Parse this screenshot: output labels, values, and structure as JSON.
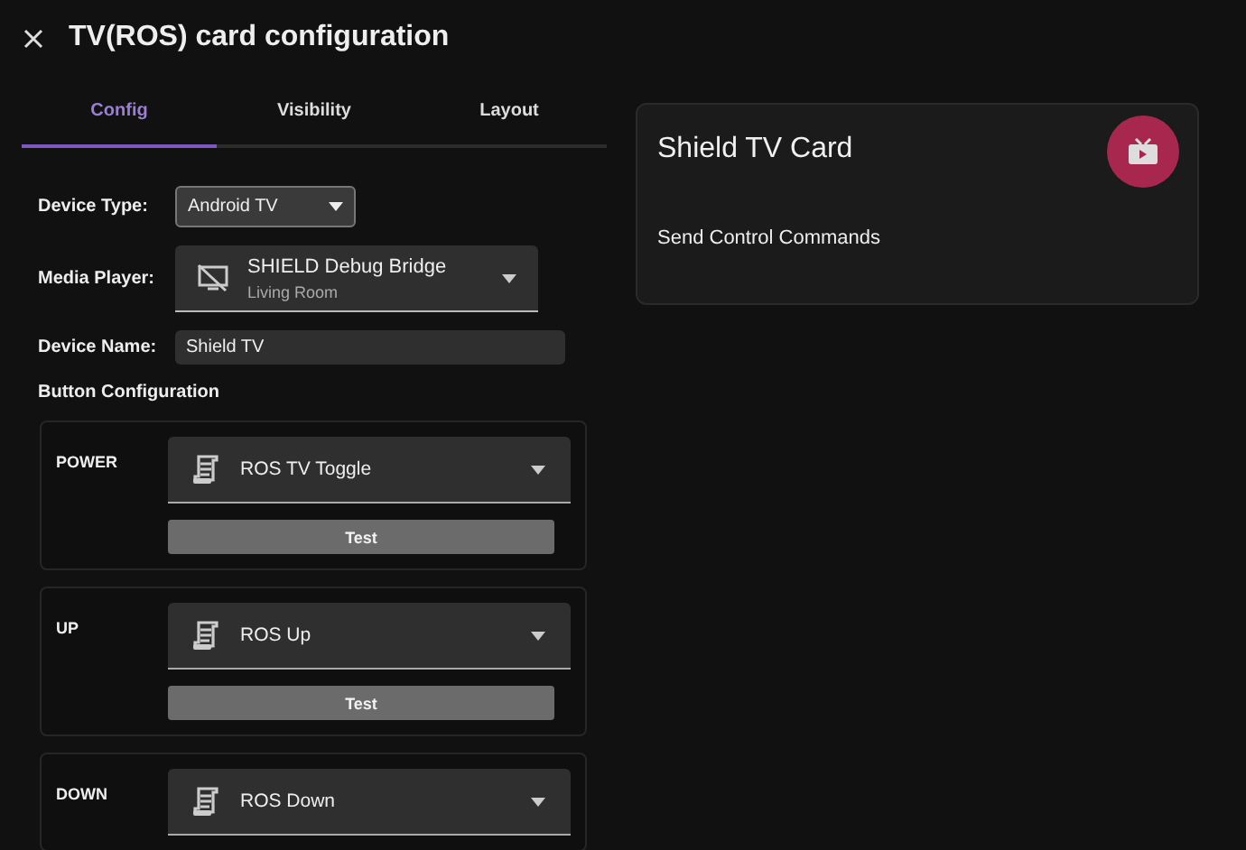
{
  "dialog": {
    "title": "TV(ROS) card configuration"
  },
  "tabs": [
    {
      "label": "Config",
      "selected": true
    },
    {
      "label": "Visibility",
      "selected": false
    },
    {
      "label": "Layout",
      "selected": false
    }
  ],
  "form": {
    "device_type": {
      "label": "Device Type:",
      "value": "Android TV"
    },
    "media_player": {
      "label": "Media Player:",
      "name": "SHIELD Debug Bridge",
      "area": "Living Room"
    },
    "device_name": {
      "label": "Device Name:",
      "value": "Shield TV"
    }
  },
  "button_configuration": {
    "heading": "Button Configuration",
    "buttons": [
      {
        "label": "POWER",
        "script": "ROS TV Toggle",
        "test": "Test"
      },
      {
        "label": "UP",
        "script": "ROS Up",
        "test": "Test"
      },
      {
        "label": "DOWN",
        "script": "ROS Down"
      }
    ]
  },
  "preview": {
    "title": "Shield TV Card",
    "subtitle": "Send Control Commands"
  }
}
